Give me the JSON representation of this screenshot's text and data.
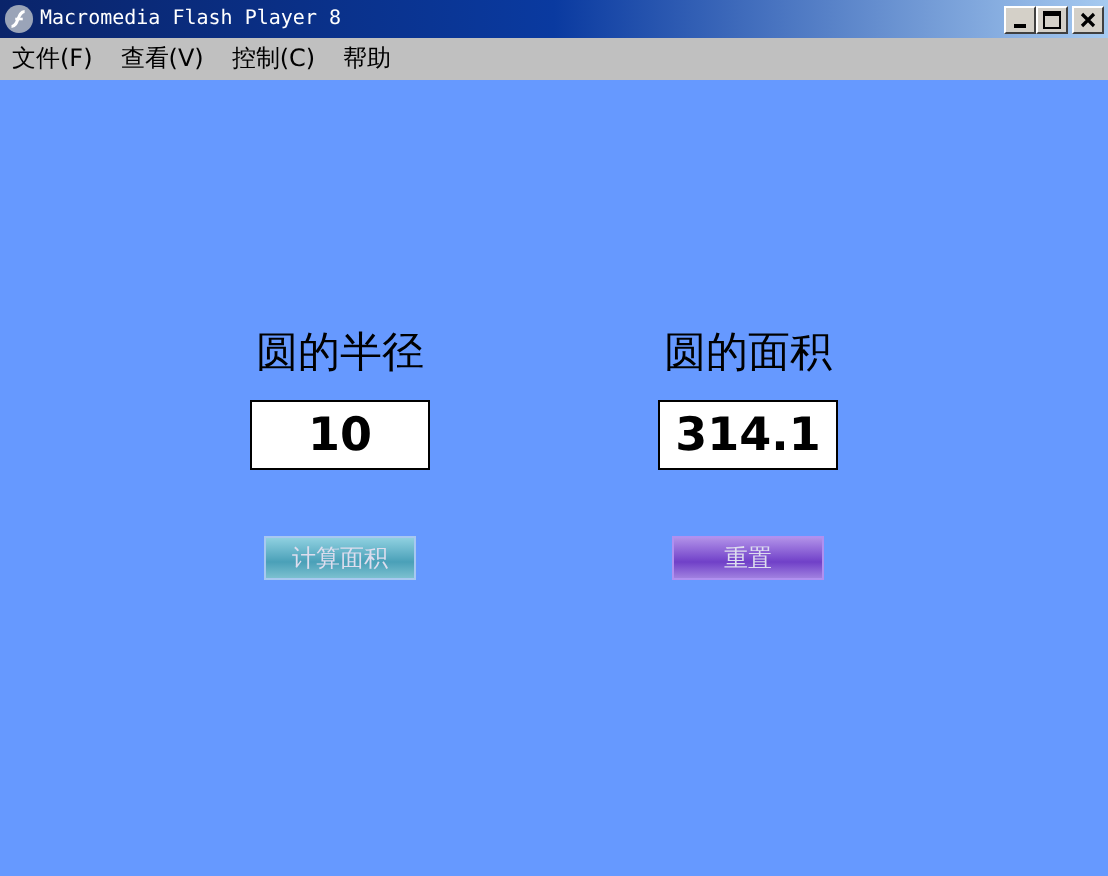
{
  "window": {
    "title": "Macromedia Flash Player 8"
  },
  "menu": [
    "文件(F)",
    "查看(V)",
    "控制(C)",
    "帮助"
  ],
  "panels": [
    {
      "label": "圆的半径",
      "value": "10",
      "button": "计算面积",
      "kind": "calc"
    },
    {
      "label": "圆的面积",
      "value": "314.1",
      "button": "重置",
      "kind": "reset"
    }
  ]
}
